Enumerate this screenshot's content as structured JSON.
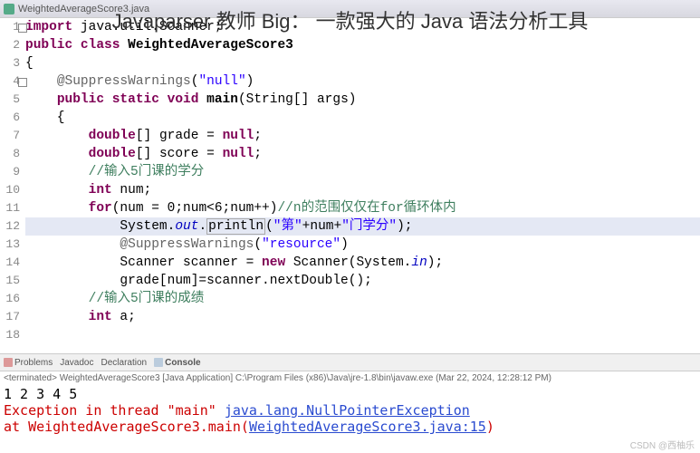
{
  "titlebar": {
    "filename": "WeightedAverageScore3.java"
  },
  "overlay": "Javaparser 教师 Big： 一款强大的 Java 语法分析工具",
  "code_lines": [
    {
      "n": 1,
      "folded": true,
      "hl": false,
      "tokens": [
        [
          "kw",
          "import "
        ],
        [
          "plain",
          "java.util.Scanner;"
        ]
      ]
    },
    {
      "n": 2,
      "folded": false,
      "hl": false,
      "tokens": [
        [
          "kw",
          "public class "
        ],
        [
          "type",
          "WeightedAverageScore3"
        ]
      ]
    },
    {
      "n": 3,
      "folded": false,
      "hl": false,
      "tokens": [
        [
          "plain",
          "{"
        ]
      ]
    },
    {
      "n": 4,
      "folded": true,
      "hl": false,
      "tokens": [
        [
          "plain",
          "    "
        ],
        [
          "ann",
          "@SuppressWarnings"
        ],
        [
          "plain",
          "("
        ],
        [
          "str",
          "\"null\""
        ],
        [
          "plain",
          ")"
        ]
      ]
    },
    {
      "n": 5,
      "folded": false,
      "hl": false,
      "tokens": [
        [
          "plain",
          "    "
        ],
        [
          "kw",
          "public static void "
        ],
        [
          "type",
          "main"
        ],
        [
          "plain",
          "(String[] args)"
        ]
      ]
    },
    {
      "n": 6,
      "folded": false,
      "hl": false,
      "tokens": [
        [
          "plain",
          "    {"
        ]
      ]
    },
    {
      "n": 7,
      "folded": false,
      "hl": false,
      "tokens": [
        [
          "plain",
          "        "
        ],
        [
          "kw",
          "double"
        ],
        [
          "plain",
          "[] grade = "
        ],
        [
          "kw",
          "null"
        ],
        [
          "plain",
          ";"
        ]
      ]
    },
    {
      "n": 8,
      "folded": false,
      "hl": false,
      "tokens": [
        [
          "plain",
          "        "
        ],
        [
          "kw",
          "double"
        ],
        [
          "plain",
          "[] score = "
        ],
        [
          "kw",
          "null"
        ],
        [
          "plain",
          ";"
        ]
      ]
    },
    {
      "n": 9,
      "folded": false,
      "hl": false,
      "tokens": [
        [
          "plain",
          "        "
        ],
        [
          "cmt",
          "//输入5门课的学分"
        ]
      ]
    },
    {
      "n": 10,
      "folded": false,
      "hl": false,
      "tokens": [
        [
          "plain",
          "        "
        ],
        [
          "kw",
          "int"
        ],
        [
          "plain",
          " num;"
        ]
      ]
    },
    {
      "n": 11,
      "folded": false,
      "hl": false,
      "tokens": [
        [
          "plain",
          "        "
        ],
        [
          "kw",
          "for"
        ],
        [
          "plain",
          "(num = 0;num<6;num++)"
        ],
        [
          "cmt",
          "//n的范围仅仅在for循环体内"
        ]
      ]
    },
    {
      "n": 12,
      "folded": false,
      "hl": true,
      "tokens": [
        [
          "plain",
          "            System."
        ],
        [
          "field",
          "out"
        ],
        [
          "plain",
          "."
        ],
        [
          "box",
          "println"
        ],
        [
          "plain",
          "("
        ],
        [
          "str",
          "\"第\""
        ],
        [
          "plain",
          "+num+"
        ],
        [
          "str",
          "\"门学分\""
        ],
        [
          "plain",
          ");"
        ]
      ]
    },
    {
      "n": 13,
      "folded": false,
      "hl": false,
      "tokens": [
        [
          "plain",
          "            "
        ],
        [
          "ann",
          "@SuppressWarnings"
        ],
        [
          "plain",
          "("
        ],
        [
          "str",
          "\"resource\""
        ],
        [
          "plain",
          ")"
        ]
      ]
    },
    {
      "n": 14,
      "folded": false,
      "hl": false,
      "tokens": [
        [
          "plain",
          "            Scanner scanner = "
        ],
        [
          "kw",
          "new"
        ],
        [
          "plain",
          " Scanner(System."
        ],
        [
          "field",
          "in"
        ],
        [
          "plain",
          ");"
        ]
      ]
    },
    {
      "n": 15,
      "folded": false,
      "hl": false,
      "tokens": [
        [
          "plain",
          "            grade[num]=scanner.nextDouble();"
        ]
      ]
    },
    {
      "n": 16,
      "folded": false,
      "hl": false,
      "tokens": [
        [
          "plain",
          "        "
        ],
        [
          "cmt",
          "//输入5门课的成绩"
        ]
      ]
    },
    {
      "n": 17,
      "folded": false,
      "hl": false,
      "tokens": [
        [
          "plain",
          "        "
        ],
        [
          "kw",
          "int"
        ],
        [
          "plain",
          " a;"
        ]
      ]
    },
    {
      "n": 18,
      "folded": false,
      "hl": false,
      "tokens": [
        [
          "plain",
          ""
        ]
      ]
    }
  ],
  "panel": {
    "tabs": [
      "Problems",
      "Javadoc",
      "Declaration",
      "Console"
    ],
    "active_tab": 3,
    "term_line": "<terminated> WeightedAverageScore3 [Java Application] C:\\Program Files (x86)\\Java\\jre-1.8\\bin\\javaw.exe (Mar 22, 2024, 12:28:12 PM)"
  },
  "console": {
    "out_line": "1 2 3 4 5",
    "err1_pre": "Exception in thread \"main\" ",
    "err1_link": "java.lang.NullPointerException",
    "err2_pre": "        at WeightedAverageScore3.main(",
    "err2_link": "WeightedAverageScore3.java:15",
    "err2_post": ")"
  },
  "watermark": "CSDN @西柚乐"
}
